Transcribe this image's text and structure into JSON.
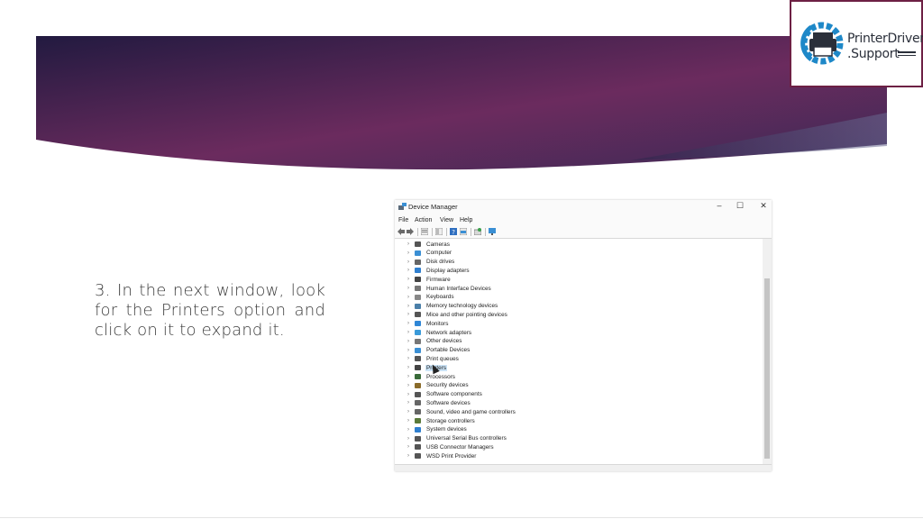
{
  "slide": {
    "instruction": "3. In the next window, look for the Printers option and click on it to expand it.",
    "banner_colors": [
      "#2b1a45",
      "#6b2a5c",
      "#3d2a5a"
    ]
  },
  "logo": {
    "line1": "PrinterDriver",
    "line2": ".Support",
    "accent": "#1e88c8",
    "icon": "printer-gear-icon"
  },
  "device_manager": {
    "title": "Device Manager",
    "window_buttons": [
      "–",
      "☐",
      "✕"
    ],
    "menu": [
      "File",
      "Action",
      "View",
      "Help"
    ],
    "toolbar_icons": [
      "back-icon",
      "forward-icon",
      "properties-icon",
      "console-tree-icon",
      "help-icon",
      "update-driver-icon",
      "scan-hardware-icon",
      "monitor-icon"
    ],
    "tree_items": [
      {
        "label": "Cameras",
        "icon": "camera-icon",
        "color": "#555555"
      },
      {
        "label": "Computer",
        "icon": "computer-icon",
        "color": "#3a8fd4"
      },
      {
        "label": "Disk drives",
        "icon": "disk-icon",
        "color": "#666666"
      },
      {
        "label": "Display adapters",
        "icon": "display-icon",
        "color": "#2f7fcf"
      },
      {
        "label": "Firmware",
        "icon": "firmware-icon",
        "color": "#444444"
      },
      {
        "label": "Human Interface Devices",
        "icon": "hid-icon",
        "color": "#777777"
      },
      {
        "label": "Keyboards",
        "icon": "keyboard-icon",
        "color": "#888888"
      },
      {
        "label": "Memory technology devices",
        "icon": "memory-icon",
        "color": "#4a7fa8"
      },
      {
        "label": "Mice and other pointing devices",
        "icon": "mouse-icon",
        "color": "#555555"
      },
      {
        "label": "Monitors",
        "icon": "monitor-icon",
        "color": "#2f86d6"
      },
      {
        "label": "Network adapters",
        "icon": "network-icon",
        "color": "#3a9ad9"
      },
      {
        "label": "Other devices",
        "icon": "other-devices-icon",
        "color": "#777777"
      },
      {
        "label": "Portable Devices",
        "icon": "portable-icon",
        "color": "#3a8fd4"
      },
      {
        "label": "Print queues",
        "icon": "print-queue-icon",
        "color": "#555555"
      },
      {
        "label": "Printers",
        "icon": "printer-icon",
        "color": "#444444",
        "selected": true
      },
      {
        "label": "Processors",
        "icon": "processor-icon",
        "color": "#3a6b3a"
      },
      {
        "label": "Security devices",
        "icon": "security-icon",
        "color": "#8a6b2a"
      },
      {
        "label": "Software components",
        "icon": "software-component-icon",
        "color": "#555555"
      },
      {
        "label": "Software devices",
        "icon": "software-device-icon",
        "color": "#666666"
      },
      {
        "label": "Sound, video and game controllers",
        "icon": "sound-icon",
        "color": "#666666"
      },
      {
        "label": "Storage controllers",
        "icon": "storage-icon",
        "color": "#5a7a3a"
      },
      {
        "label": "System devices",
        "icon": "system-icon",
        "color": "#2f7fcf"
      },
      {
        "label": "Universal Serial Bus controllers",
        "icon": "usb-icon",
        "color": "#555555"
      },
      {
        "label": "USB Connector Managers",
        "icon": "usb-connector-icon",
        "color": "#555555"
      },
      {
        "label": "WSD Print Provider",
        "icon": "wsd-printer-icon",
        "color": "#555555"
      }
    ]
  }
}
